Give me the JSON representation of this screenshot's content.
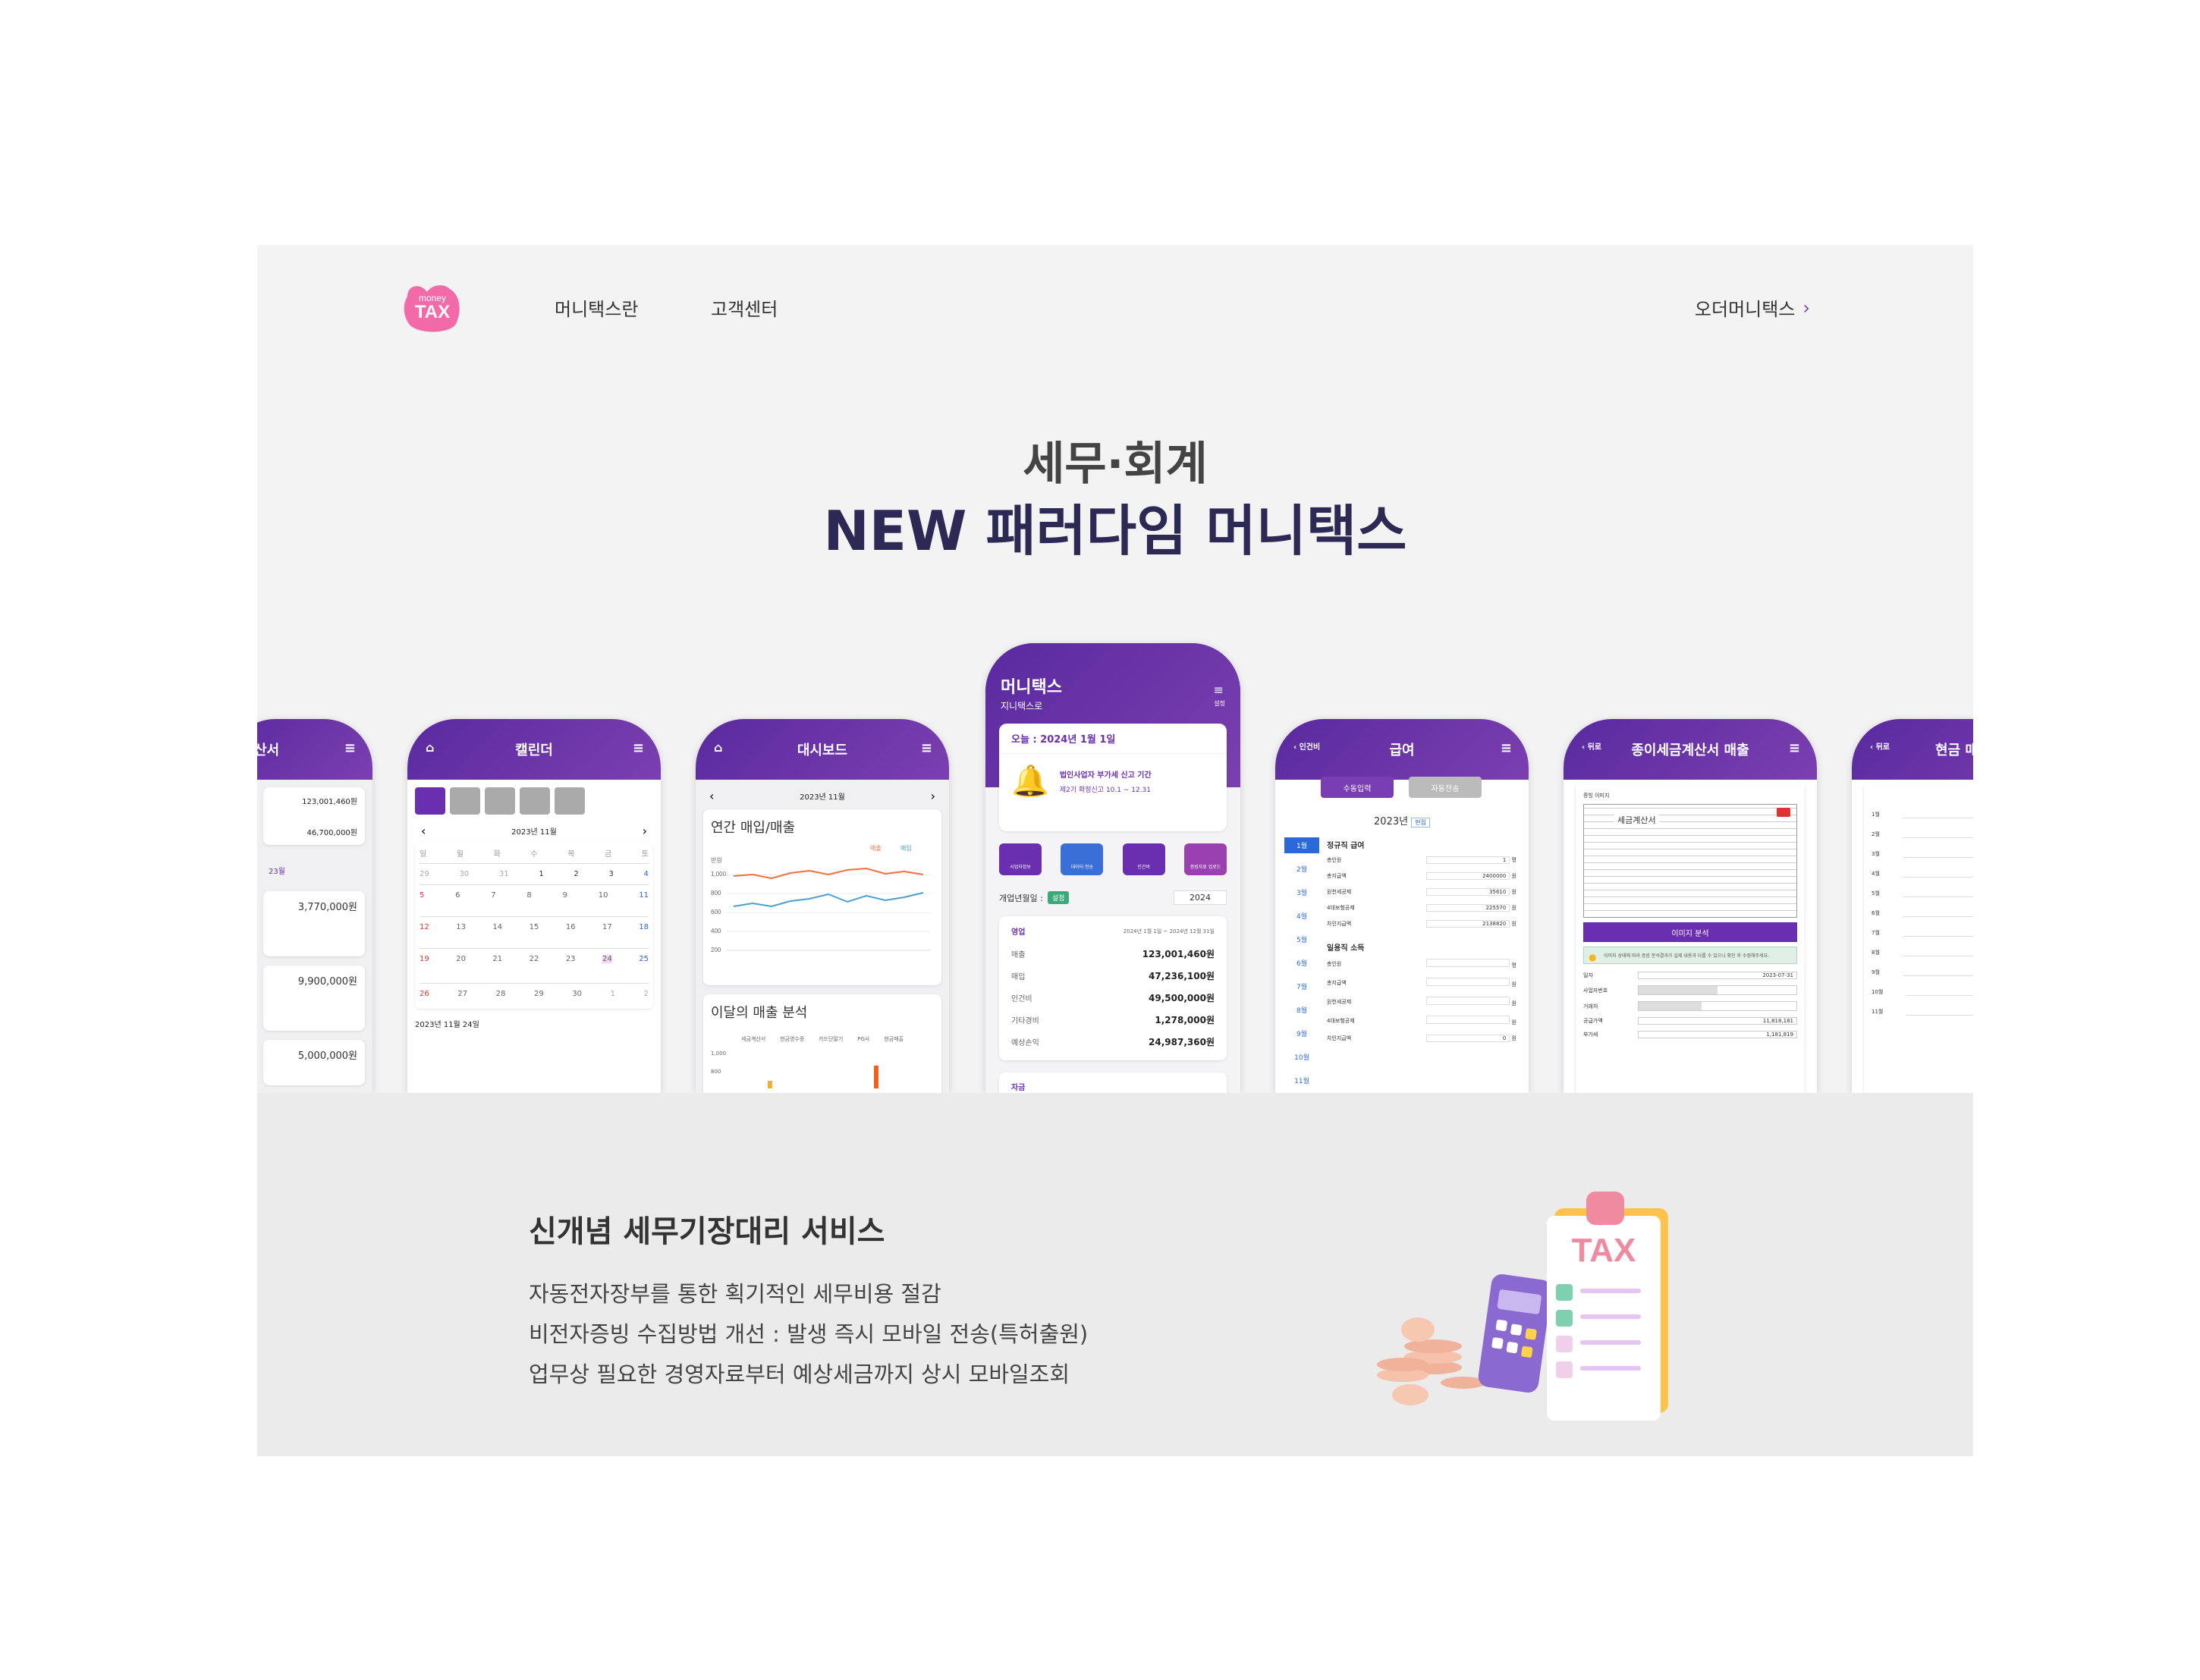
{
  "header": {
    "logo_top": "money",
    "logo_main": "TAX",
    "nav": [
      "머니택스란",
      "고객센터"
    ],
    "order": "오더머니택스"
  },
  "hero": {
    "line1": "세무·회계",
    "line2": "NEW 패러다임 머니택스"
  },
  "colors": {
    "purple": "#6a2fb0",
    "navy": "#2c2a54",
    "pink": "#f26aa8"
  },
  "phones": {
    "p0": {
      "title": "산서",
      "v1": "123,001,460원",
      "v2": "46,700,000원",
      "month": "23월",
      "a1": "3,770,000원",
      "a2": "9,900,000원",
      "a3": "5,000,000원"
    },
    "p1": {
      "title": "캘린더",
      "month": "2023년 11월",
      "days": [
        "일",
        "월",
        "화",
        "수",
        "목",
        "금",
        "토"
      ],
      "w1": [
        "29",
        "30",
        "31",
        "1",
        "2",
        "3",
        "4"
      ],
      "w2": [
        "5",
        "6",
        "7",
        "8",
        "9",
        "10",
        "11"
      ],
      "w3": [
        "12",
        "13",
        "14",
        "15",
        "16",
        "17",
        "18"
      ],
      "w4": [
        "19",
        "20",
        "21",
        "22",
        "23",
        "24",
        "25"
      ],
      "w5": [
        "26",
        "27",
        "28",
        "29",
        "30",
        "1",
        "2"
      ],
      "foot": "2023년 11월 24일"
    },
    "p2": {
      "title": "대시보드",
      "month": "2023년 11월",
      "card1": "연간 매입/매출",
      "legend1": "매출",
      "legend2": "매입",
      "unit": "만원",
      "yt": [
        "1,000",
        "800",
        "600",
        "400",
        "200",
        "0"
      ],
      "card2": "이달의 매출 분석",
      "cats": [
        "세금계산서",
        "현금영수증",
        "카드단말기",
        "PG사",
        "현금매출"
      ],
      "yt2": [
        "1,000",
        "800"
      ]
    },
    "p3": {
      "title": "머니택스",
      "sub": "지니택스로",
      "menu": "설정",
      "today": "오늘 : 2024년 1월 1일",
      "notice1": "법인사업자 부가세 신고 기간",
      "notice2": "제2기 확정신고 10.1 ~ 12.31",
      "btns": [
        "사업자정보",
        "데이터 전송",
        "인건비",
        "증빙자료 업로드"
      ],
      "opening": "개업년월일 :",
      "badge": "설정",
      "year": "2024",
      "block": "영업",
      "range": "2024년 1월 1일 ~ 2024년 12월 31일",
      "rows": [
        [
          "매출",
          "123,001,460원"
        ],
        [
          "매입",
          "47,236,100원"
        ],
        [
          "인건비",
          "49,500,000원"
        ],
        [
          "기타경비",
          "1,278,000원"
        ],
        [
          "예상손익",
          "24,987,360원"
        ]
      ],
      "block2": "자금"
    },
    "p4": {
      "title": "급여",
      "back": "인건비",
      "tab1": "수동입력",
      "tab2": "자동전송",
      "year": "2023년",
      "badge": "편집",
      "months": [
        "1월",
        "2월",
        "3월",
        "4월",
        "5월",
        "6월",
        "7월",
        "8월",
        "9월",
        "10월",
        "11월"
      ],
      "reg": "정규직 급여",
      "day": "일용직 소득",
      "labels": [
        "총인원",
        "총지급액",
        "원천세공제",
        "4대보험공제",
        "차인지급액"
      ],
      "vals": [
        "1",
        "2400000",
        "35610",
        "225570",
        "2138820"
      ],
      "units": [
        "명",
        "원",
        "원",
        "원",
        "원"
      ],
      "dvals": [
        "",
        "",
        "",
        "",
        "0"
      ]
    },
    "p5": {
      "title": "종이세금계산서 매출",
      "back": "뒤로",
      "label": "증빙 이미지",
      "doc": "세금계산서",
      "btn": "이미지 분석",
      "warn": "이미지 상태에 따라 증빙 분석결과가 실제 내용과 다를 수 있으니 확인 후 수정해주세요.",
      "fields": [
        "일자",
        "사업자번호",
        "거래처",
        "공급가액",
        "부가세"
      ],
      "date": "2023-07-31",
      "amt1": "11,818,181",
      "amt2": "1,181,819"
    },
    "p6": {
      "title": "현금 매",
      "back": "뒤로",
      "year": "20",
      "months": [
        "1월",
        "2월",
        "3월",
        "4월",
        "5월",
        "6월",
        "7월",
        "8월",
        "9월",
        "10월",
        "11월"
      ]
    }
  },
  "section": {
    "title": "신개념 세무기장대리 서비스",
    "lines": [
      "자동전자장부를 통한 획기적인 세무비용 절감",
      "비전자증빙 수집방법 개선 : 발생 즉시 모바일 전송(특허출원)",
      "업무상 필요한 경영자료부터 예상세금까지 상시 모바일조회"
    ],
    "illus_text": "TAX"
  }
}
